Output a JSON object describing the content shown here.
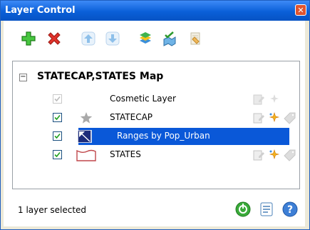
{
  "window": {
    "title": "Layer Control",
    "close_glyph": "✕"
  },
  "toolbar": {
    "buttons": [
      {
        "name": "add-layer",
        "icon": "plus-icon"
      },
      {
        "name": "remove-layer",
        "icon": "x-icon"
      },
      {
        "name": "move-up",
        "icon": "arrow-up-icon"
      },
      {
        "name": "move-down",
        "icon": "arrow-down-icon"
      },
      {
        "name": "layer-properties",
        "icon": "layers-icon"
      },
      {
        "name": "map-options",
        "icon": "map-check-icon"
      },
      {
        "name": "clear-layers",
        "icon": "erase-icon"
      }
    ]
  },
  "tree": {
    "expander_glyph": "−",
    "map_name": "STATECAP,STATES Map",
    "layers": [
      {
        "label": "Cosmetic Layer",
        "checked": true,
        "enabled": false,
        "selected": false,
        "icon": "none"
      },
      {
        "label": "STATECAP",
        "checked": true,
        "enabled": true,
        "selected": false,
        "icon": "star-icon"
      },
      {
        "label": "Ranges by Pop_Urban",
        "checked": true,
        "enabled": true,
        "selected": true,
        "icon": "ranges-icon"
      },
      {
        "label": "STATES",
        "checked": true,
        "enabled": true,
        "selected": false,
        "icon": "region-icon"
      }
    ]
  },
  "status": {
    "text": "1 layer selected"
  },
  "footer": {
    "buttons": [
      {
        "name": "ok",
        "icon": "green-circle-icon"
      },
      {
        "name": "apply",
        "icon": "document-icon"
      },
      {
        "name": "help",
        "icon": "question-icon"
      }
    ]
  },
  "colors": {
    "title_bar": "#0a5fd8",
    "selection": "#0a58d8",
    "panel_border": "#9aa0a6"
  }
}
